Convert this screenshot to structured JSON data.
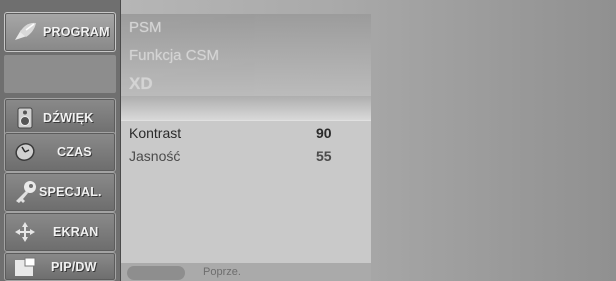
{
  "sidebar": {
    "items": [
      {
        "label": "PROGRAM",
        "icon": "satellite-dish-icon",
        "active": true
      },
      {
        "label": "DŹWIĘK",
        "icon": "speaker-icon",
        "active": false
      },
      {
        "label": "CZAS",
        "icon": "clock-icon",
        "active": false
      },
      {
        "label": "SPECJAL.",
        "icon": "key-icon",
        "active": false
      },
      {
        "label": "EKRAN",
        "icon": "move-arrows-icon",
        "active": false
      },
      {
        "label": "PIP/DW",
        "icon": "pip-window-icon",
        "active": false
      }
    ]
  },
  "top_menu": {
    "items": [
      "PSM",
      "Funkcja CSM",
      "XD"
    ]
  },
  "main_menu": {
    "rows": [
      {
        "name": "Kontrast",
        "value": "90"
      },
      {
        "name": "Jasność",
        "value": "55"
      }
    ]
  },
  "help": {
    "text": "Poprze."
  },
  "colors": {
    "sidebar_bg": "#6f6f6f",
    "panel_bg": "#c9c9c9",
    "text_light": "#f2f2f2"
  }
}
